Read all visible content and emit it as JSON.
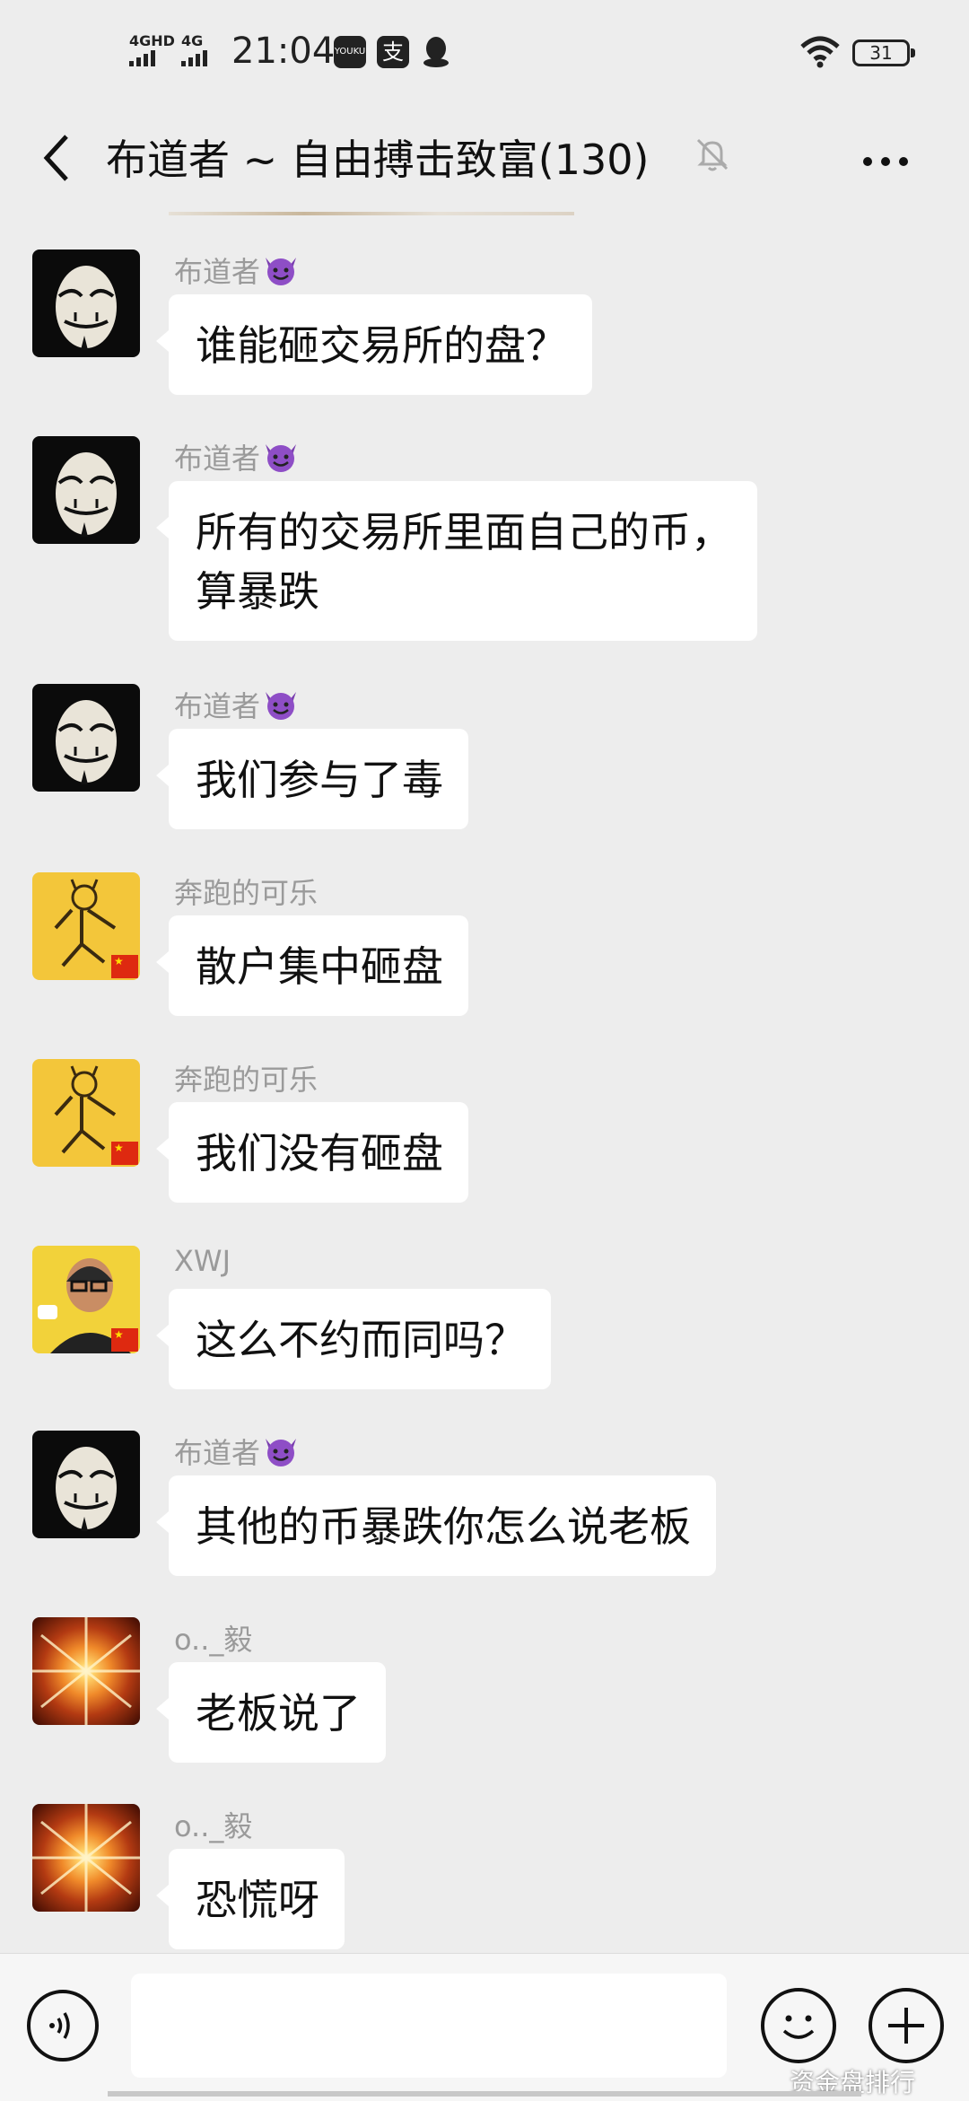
{
  "status_bar": {
    "network1": "4GHD",
    "network2": "4G",
    "time": "21:04",
    "app_icons": [
      "youku-icon",
      "alipay-icon",
      "qq-icon"
    ],
    "youku_text": "YOUKU",
    "alipay_text": "支",
    "battery": "31"
  },
  "header": {
    "title": "布道者 ~ 自由搏击致富(130)"
  },
  "messages": [
    {
      "sender": "布道者",
      "devil": true,
      "avatar": "mask",
      "text": [
        "谁能砸交易所的盘？"
      ]
    },
    {
      "sender": "布道者",
      "devil": true,
      "avatar": "mask",
      "text": [
        "所有的交易所里面自己的币，",
        "算暴跌"
      ]
    },
    {
      "sender": "布道者",
      "devil": true,
      "avatar": "mask",
      "text": [
        "我们参与了毒"
      ]
    },
    {
      "sender": "奔跑的可乐",
      "devil": false,
      "avatar": "dog",
      "text": [
        "散户集中砸盘"
      ]
    },
    {
      "sender": "奔跑的可乐",
      "devil": false,
      "avatar": "dog",
      "text": [
        "我们没有砸盘"
      ]
    },
    {
      "sender": "XWJ",
      "devil": false,
      "avatar": "xwj",
      "text": [
        "这么不约而同吗？"
      ]
    },
    {
      "sender": "布道者",
      "devil": true,
      "avatar": "mask",
      "text": [
        "其他的币暴跌你怎么说老板"
      ]
    },
    {
      "sender": "o.._毅",
      "devil": false,
      "avatar": "burst",
      "text": [
        "老板说了"
      ]
    },
    {
      "sender": "o.._毅",
      "devil": false,
      "avatar": "burst",
      "text": [
        "恐慌呀"
      ]
    }
  ],
  "input_bar": {
    "input_value": "",
    "watermark": "资金盘排行"
  },
  "colors": {
    "background": "#ededed",
    "bubble": "#ffffff",
    "sender_text": "#9a9a9a"
  }
}
